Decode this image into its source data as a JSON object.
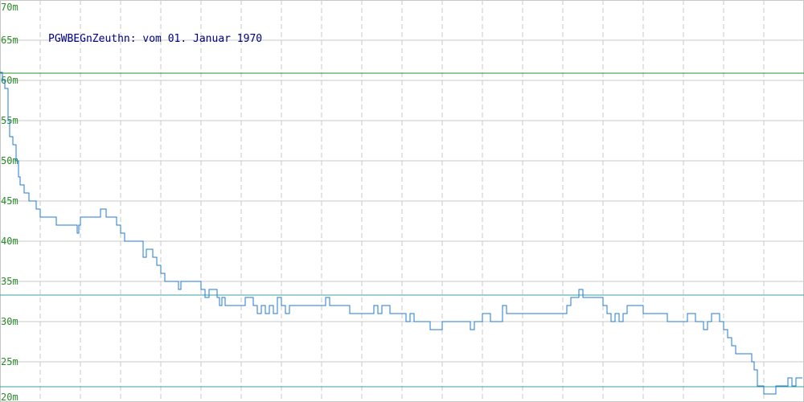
{
  "chart_data": {
    "type": "line",
    "title": "PGWBEGnZeuthn: vom 01. Januar 1970",
    "xlabel": "",
    "ylabel": "",
    "ylim": [
      20,
      70
    ],
    "xlim": [
      0,
      1000
    ],
    "y_ticks": [
      70,
      65,
      60,
      55,
      50,
      45,
      40,
      35,
      30,
      25,
      20
    ],
    "y_tick_labels": [
      "70m",
      "65m",
      "60m",
      "55m",
      "50m",
      "45m",
      "40m",
      "35m",
      "30m",
      "25m",
      "20m"
    ],
    "x_grid_count": 20,
    "grid": true,
    "reference_lines": [
      {
        "value": 60.9,
        "color": "#2e8b2e"
      },
      {
        "value": 33.3,
        "color": "#3aa0a0"
      },
      {
        "value": 21.9,
        "color": "#3aa0a0"
      }
    ],
    "series": [
      {
        "color": "#1f7ad6",
        "x": [
          0,
          3,
          6,
          10,
          12,
          14,
          16,
          20,
          23,
          25,
          28,
          30,
          33,
          36,
          40,
          45,
          50,
          55,
          60,
          65,
          70,
          80,
          90,
          96,
          98,
          100,
          105,
          110,
          115,
          120,
          125,
          128,
          132,
          135,
          140,
          145,
          150,
          155,
          160,
          170,
          178,
          182,
          186,
          190,
          195,
          200,
          205,
          210,
          215,
          220,
          222,
          225,
          235,
          245,
          250,
          255,
          257,
          260,
          265,
          270,
          273,
          276,
          280,
          285,
          290,
          300,
          305,
          310,
          315,
          320,
          325,
          330,
          335,
          340,
          345,
          350,
          355,
          360,
          365,
          370,
          380,
          390,
          400,
          405,
          410,
          420,
          430,
          435,
          440,
          450,
          460,
          465,
          470,
          475,
          480,
          485,
          490,
          495,
          500,
          505,
          510,
          515,
          520,
          525,
          530,
          535,
          540,
          545,
          550,
          560,
          570,
          580,
          585,
          590,
          595,
          600,
          610,
          620,
          625,
          630,
          640,
          650,
          660,
          670,
          680,
          690,
          700,
          705,
          710,
          715,
          720,
          725,
          730,
          740,
          750,
          755,
          760,
          765,
          770,
          775,
          780,
          785,
          790,
          800,
          810,
          820,
          830,
          840,
          850,
          855,
          860,
          865,
          870,
          875,
          880,
          885,
          890,
          895,
          900,
          905,
          910,
          915,
          920,
          925,
          930,
          935,
          938,
          942,
          946,
          950,
          955,
          960,
          965,
          970,
          975,
          980,
          985,
          990,
          998
        ],
        "values": [
          61,
          60,
          59,
          55,
          53,
          53,
          52,
          50,
          48,
          47,
          47,
          46,
          46,
          45,
          45,
          44,
          43,
          43,
          43,
          43,
          42,
          42,
          42,
          41,
          42,
          43,
          43,
          43,
          43,
          43,
          44,
          44,
          43,
          43,
          43,
          42,
          41,
          40,
          40,
          40,
          38,
          39,
          39,
          38,
          37,
          36,
          35,
          35,
          35,
          35,
          34,
          35,
          35,
          35,
          34,
          33,
          33,
          34,
          34,
          33,
          32,
          33,
          32,
          32,
          32,
          32,
          33,
          33,
          32,
          31,
          32,
          31,
          32,
          31,
          33,
          32,
          31,
          32,
          32,
          32,
          32,
          32,
          32,
          33,
          32,
          32,
          32,
          31,
          31,
          31,
          31,
          32,
          31,
          32,
          32,
          31,
          31,
          31,
          31,
          30,
          31,
          30,
          30,
          30,
          30,
          29,
          29,
          29,
          30,
          30,
          30,
          30,
          29,
          30,
          30,
          31,
          30,
          30,
          32,
          31,
          31,
          31,
          31,
          31,
          31,
          31,
          31,
          32,
          33,
          33,
          34,
          33,
          33,
          33,
          32,
          31,
          30,
          31,
          30,
          31,
          32,
          32,
          32,
          31,
          31,
          31,
          30,
          30,
          30,
          31,
          31,
          30,
          30,
          29,
          30,
          31,
          31,
          30,
          29,
          28,
          27,
          26,
          26,
          26,
          26,
          25,
          24,
          22,
          22,
          21,
          21,
          21,
          22,
          22,
          22,
          23,
          22,
          23,
          23
        ]
      }
    ]
  }
}
